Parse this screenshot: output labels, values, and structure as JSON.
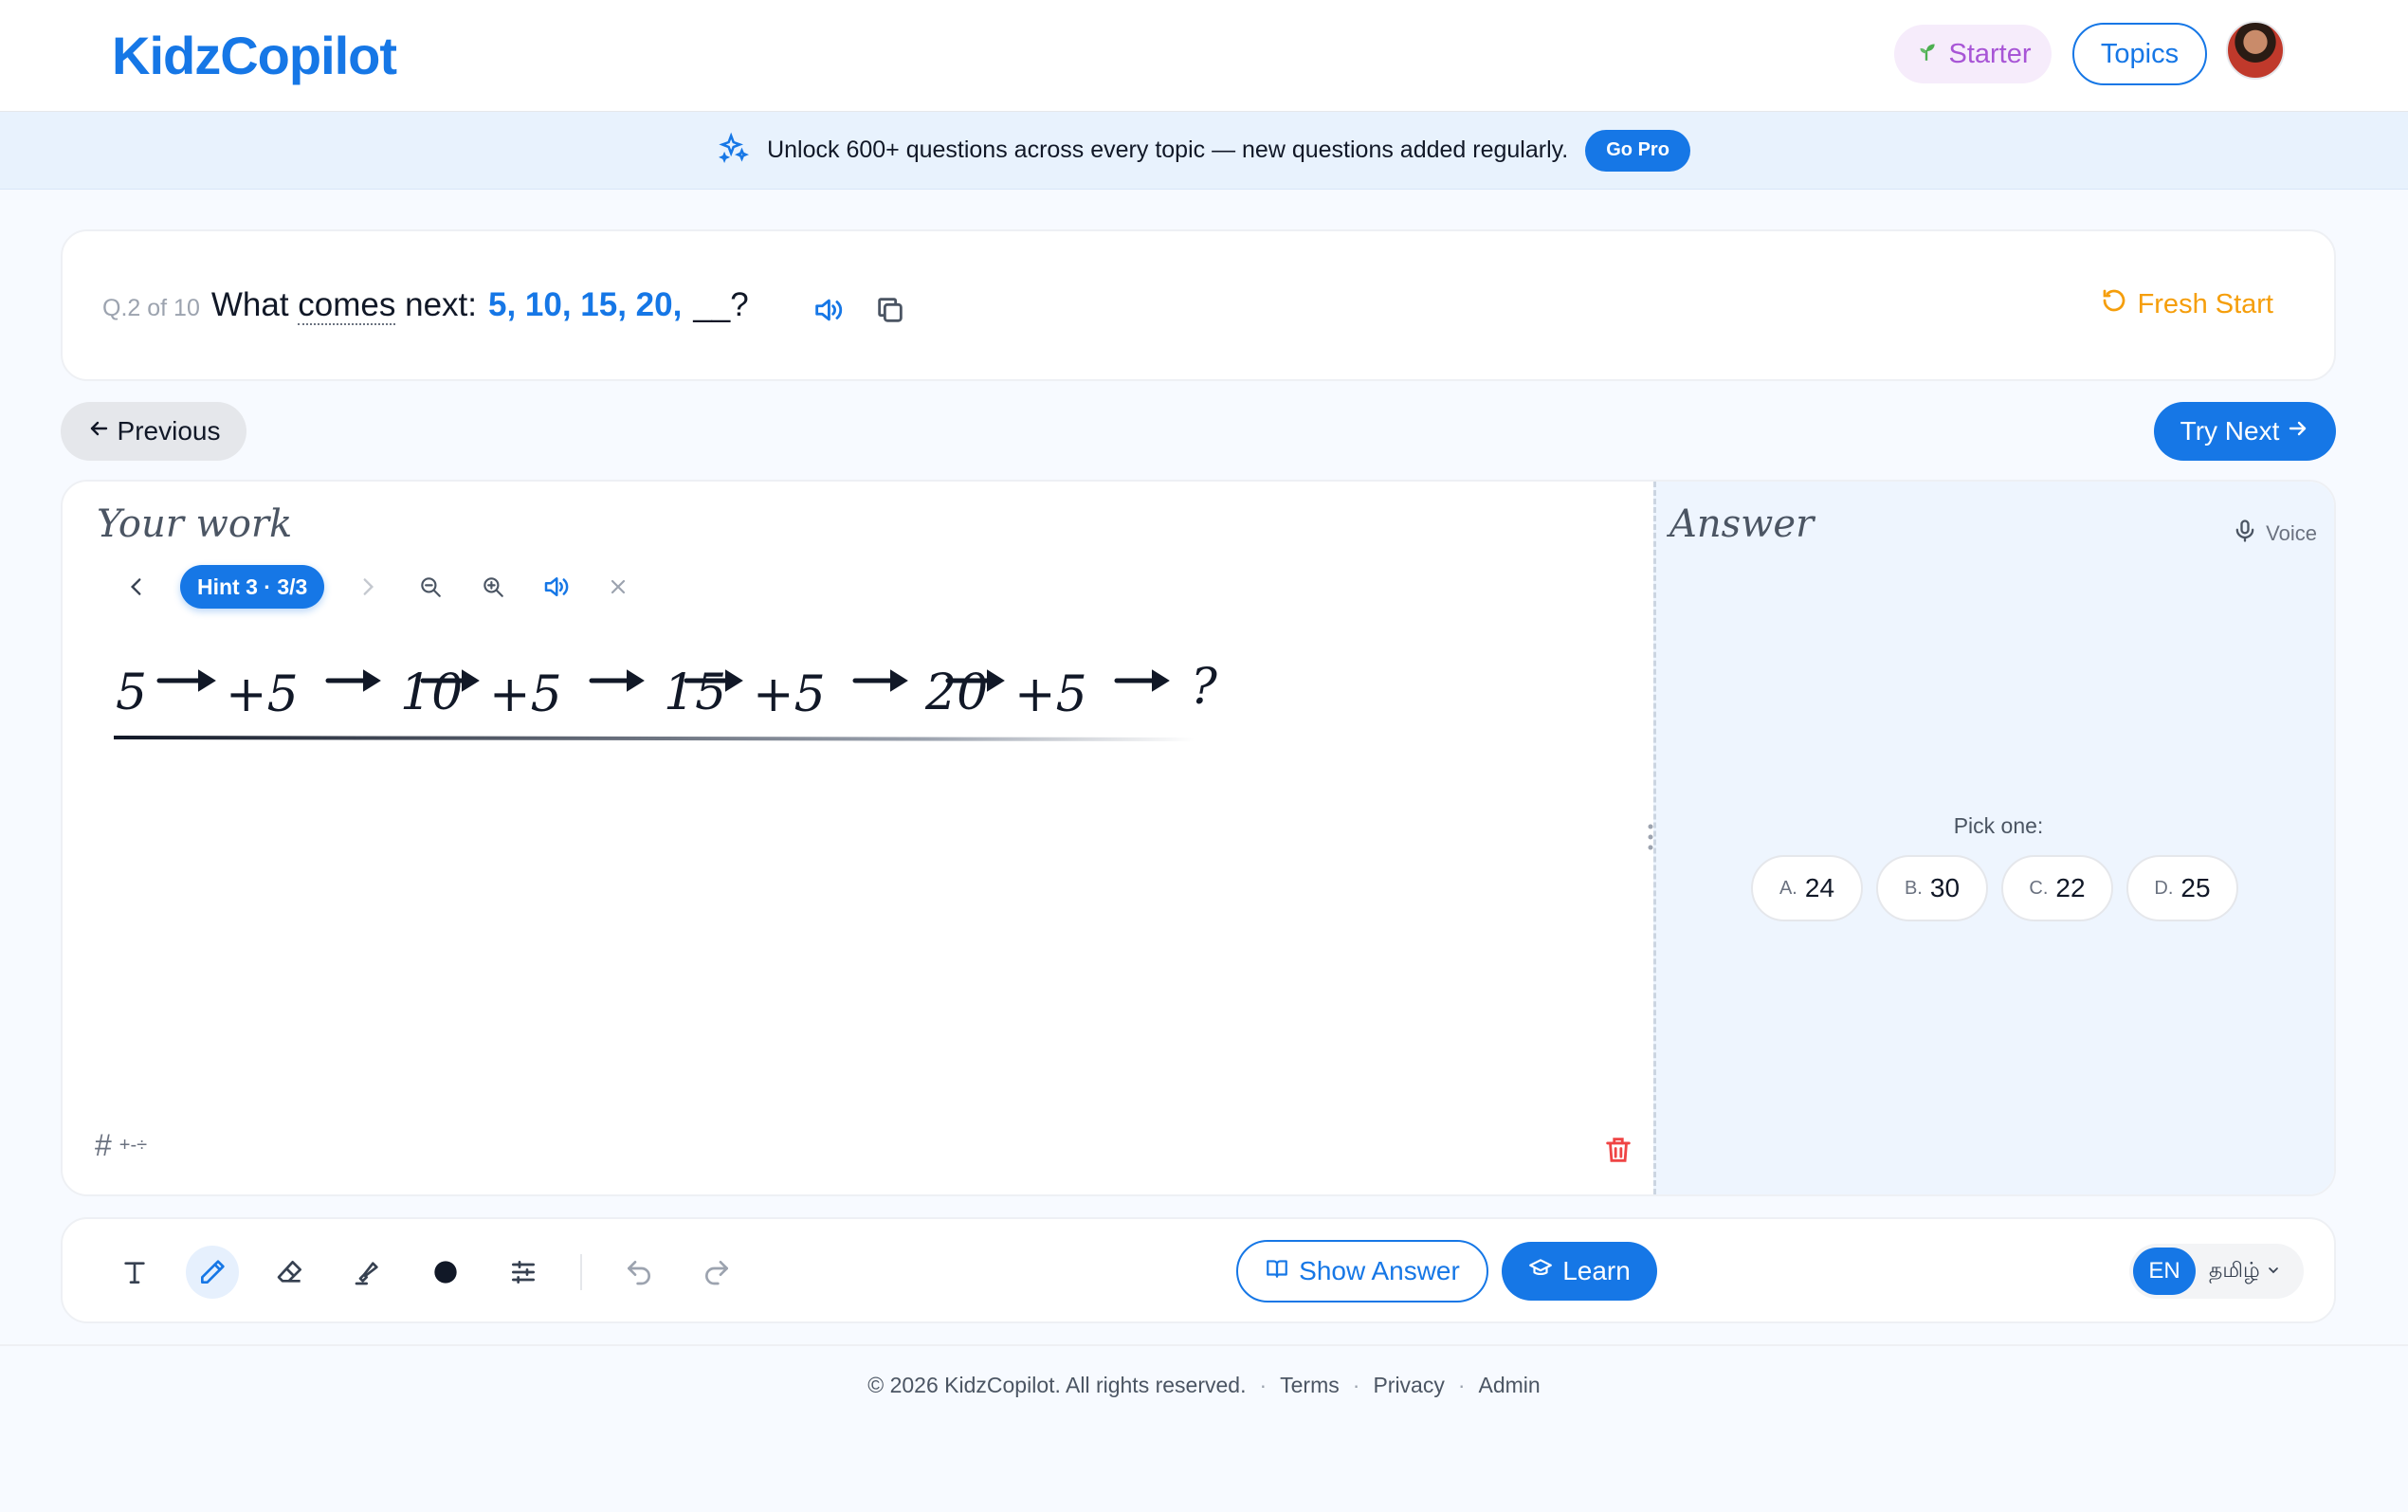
{
  "header": {
    "logo": "KidzCopilot",
    "plan_label": "Starter",
    "topics_label": "Topics"
  },
  "promo": {
    "text": "Unlock 600+ questions across every topic — new questions added regularly.",
    "cta": "Go Pro"
  },
  "question": {
    "counter": "Q.2 of 10",
    "prefix_1": "What",
    "prefix_word": "comes",
    "prefix_2": "next:",
    "sequence": "5, 10, 15, 20,",
    "blank": "__?",
    "fresh_start": "Fresh Start"
  },
  "nav": {
    "previous": "Previous",
    "next": "Try Next"
  },
  "work": {
    "title": "Your work",
    "hint_label": "Hint 3 · 3/3",
    "handwriting": [
      "5",
      "+5",
      "10",
      "+5",
      "15",
      "+5",
      "20",
      "+5",
      "?"
    ],
    "hash_label": "#",
    "ops_label": "+-÷"
  },
  "answer": {
    "title": "Answer",
    "voice_label": "Voice",
    "pick_label": "Pick one:",
    "choices": [
      {
        "letter": "A.",
        "value": "24"
      },
      {
        "letter": "B.",
        "value": "30"
      },
      {
        "letter": "C.",
        "value": "22"
      },
      {
        "letter": "D.",
        "value": "25"
      }
    ]
  },
  "toolbar": {
    "show_answer": "Show Answer",
    "learn": "Learn",
    "lang_en": "EN",
    "lang_other": "தமிழ்"
  },
  "footer": {
    "copyright": "© 2026 KidzCopilot. All rights reserved.",
    "terms": "Terms",
    "privacy": "Privacy",
    "admin": "Admin"
  },
  "colors": {
    "brand": "#1677e6",
    "fresh_start": "#f59e0b",
    "delete": "#ef4444",
    "starter": "#a855d6"
  }
}
